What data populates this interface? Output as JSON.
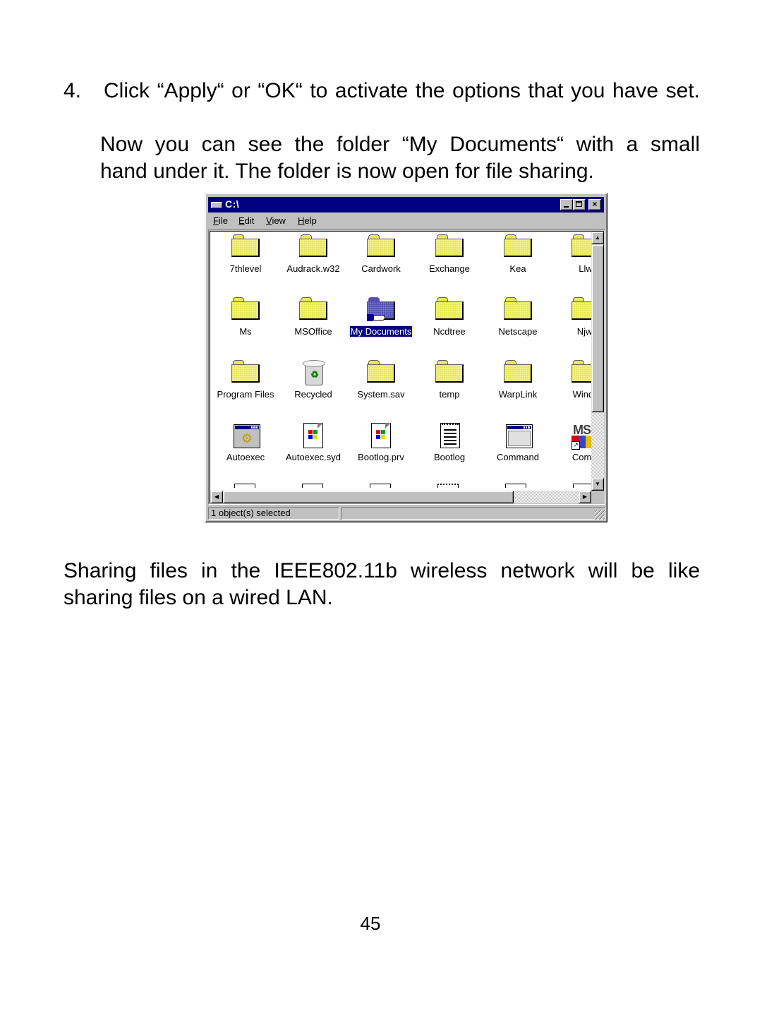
{
  "document": {
    "step_number": "4.",
    "step_text": "Click “Apply“ or “OK“ to activate the options that you have set.",
    "note_line1": "Now you can see the folder “My Documents“ with a small",
    "note_line2": "hand under it. The folder is now open for file sharing.",
    "share_line1": "Sharing files in the IEEE802.11b wireless network will be like",
    "share_line2": "sharing files on a wired LAN.",
    "page_number": "45"
  },
  "window": {
    "title": "C:\\",
    "title_icon": "drive-icon",
    "caption_buttons": [
      "minimize",
      "maximize",
      "close"
    ],
    "close_glyph": "×",
    "menu": [
      {
        "label": "File",
        "accel": "F",
        "rest": "ile"
      },
      {
        "label": "Edit",
        "accel": "E",
        "rest": "dit"
      },
      {
        "label": "View",
        "accel": "V",
        "rest": "iew"
      },
      {
        "label": "Help",
        "accel": "H",
        "rest": "elp"
      }
    ],
    "items": [
      {
        "label": "7thlevel",
        "type": "folder"
      },
      {
        "label": "Audrack.w32",
        "type": "folder"
      },
      {
        "label": "Cardwork",
        "type": "folder"
      },
      {
        "label": "Exchange",
        "type": "folder"
      },
      {
        "label": "Kea",
        "type": "folder"
      },
      {
        "label": "Llw",
        "type": "folder"
      },
      {
        "label": "Ms",
        "type": "folder"
      },
      {
        "label": "MSOffice",
        "type": "folder"
      },
      {
        "label": "My Documents",
        "type": "shared-folder",
        "selected": true
      },
      {
        "label": "Ncdtree",
        "type": "folder"
      },
      {
        "label": "Netscape",
        "type": "folder"
      },
      {
        "label": "Njwi",
        "type": "folder"
      },
      {
        "label": "Program Files",
        "type": "folder"
      },
      {
        "label": "Recycled",
        "type": "recycle-bin"
      },
      {
        "label": "System.sav",
        "type": "folder"
      },
      {
        "label": "temp",
        "type": "folder"
      },
      {
        "label": "WarpLink",
        "type": "folder"
      },
      {
        "label": "Windo",
        "type": "folder"
      },
      {
        "label": "Autoexec",
        "type": "batch-file"
      },
      {
        "label": "Autoexec.syd",
        "type": "system-file"
      },
      {
        "label": "Bootlog.prv",
        "type": "system-file"
      },
      {
        "label": "Bootlog",
        "type": "text-file"
      },
      {
        "label": "Command",
        "type": "application"
      },
      {
        "label": "Comm",
        "type": "msdos-shortcut"
      }
    ],
    "status": {
      "selection": "1 object(s) selected",
      "secondary": ""
    }
  }
}
